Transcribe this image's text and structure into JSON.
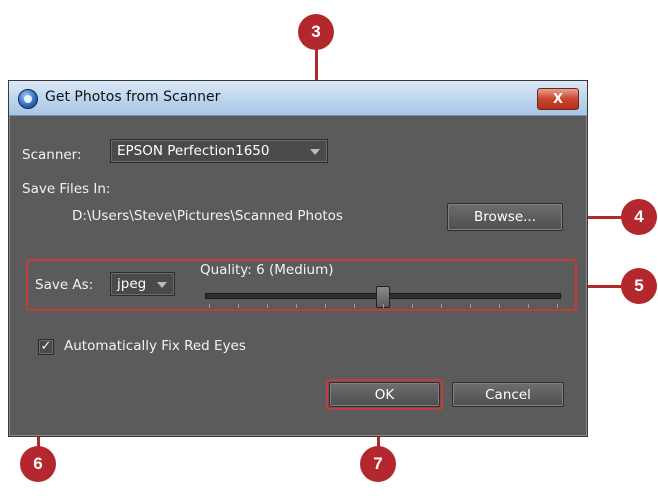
{
  "dialog": {
    "title": "Get Photos from Scanner",
    "close_label": "X"
  },
  "scanner": {
    "label": "Scanner:",
    "value": "EPSON Perfection1650"
  },
  "save_files": {
    "label": "Save Files In:",
    "path": "D:\\Users\\Steve\\Pictures\\Scanned Photos",
    "browse_label": "Browse..."
  },
  "save_as": {
    "label": "Save As:",
    "value": "jpeg",
    "quality_label": "Quality: 6 (Medium)",
    "quality_value": 6,
    "quality_max": 12
  },
  "red_eye": {
    "label": "Automatically Fix Red Eyes",
    "checked": true,
    "check_glyph": "✓"
  },
  "buttons": {
    "ok": "OK",
    "cancel": "Cancel"
  },
  "callouts": [
    "3",
    "4",
    "5",
    "6",
    "7"
  ],
  "colors": {
    "callout": "#b3282c",
    "dialog_bg": "#5b5b5b"
  }
}
